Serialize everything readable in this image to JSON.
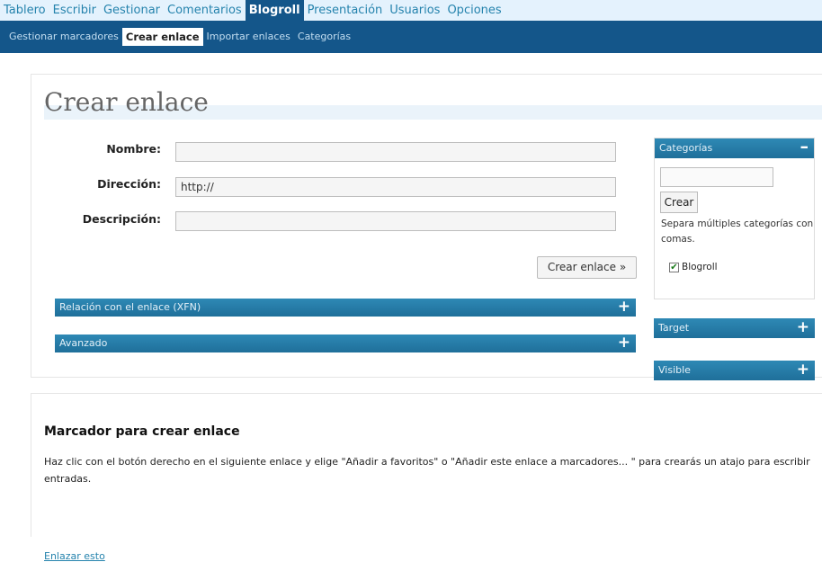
{
  "nav": {
    "items": [
      "Tablero",
      "Escribir",
      "Gestionar",
      "Comentarios",
      "Blogroll",
      "Presentación",
      "Usuarios",
      "Opciones"
    ],
    "active": "Blogroll"
  },
  "subnav": {
    "items": [
      "Gestionar marcadores",
      "Crear enlace",
      "Importar enlaces",
      "Categorías"
    ],
    "active": "Crear enlace"
  },
  "form": {
    "title": "Crear enlace",
    "name_label": "Nombre:",
    "name_value": "",
    "url_label": "Dirección:",
    "url_value": "http://",
    "desc_label": "Descripción:",
    "desc_value": "",
    "submit_label": "Crear enlace »",
    "sections": [
      {
        "label": "Relación con el enlace (XFN)",
        "icon": "plus-icon"
      },
      {
        "label": "Avanzado",
        "icon": "plus-icon"
      }
    ]
  },
  "sidebar": {
    "categories": {
      "title": "Categorías",
      "toggle_icon": "minus-icon",
      "add_value": "",
      "add_button": "Crear",
      "hint": "Separa múltiples categorías con comas.",
      "items": [
        {
          "label": "Blogroll",
          "checked": true
        }
      ]
    },
    "target": {
      "title": "Target",
      "toggle_icon": "plus-icon"
    },
    "visible": {
      "title": "Visible",
      "toggle_icon": "plus-icon"
    }
  },
  "bookmarklet": {
    "title": "Marcador para crear enlace",
    "text": "Haz clic con el botón derecho en el siguiente enlace y elige \"Añadir a favoritos\" o \"Añadir este enlace a marcadores... \" para crearás un atajo para escribir entradas.",
    "link": "Enlazar esto"
  },
  "colors": {
    "nav_bg": "#e4f2fd",
    "nav_active": "#14568a",
    "subnav_bg": "#14568a",
    "bar_blue": "#2583ad"
  }
}
